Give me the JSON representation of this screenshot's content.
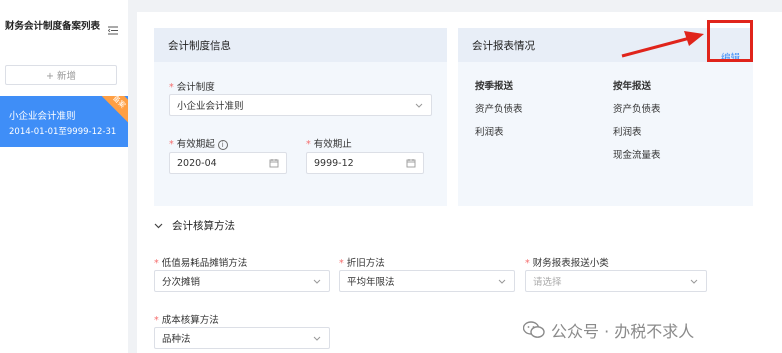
{
  "sidebar": {
    "title": "财务会计制度备案列表",
    "add_label": "+ 新增",
    "items": [
      {
        "name": "小企业会计准则",
        "range": "2014-01-01至9999-12-31",
        "badge": "备案"
      }
    ]
  },
  "system_card": {
    "title": "会计制度信息",
    "system_label": "会计制度",
    "system_value": "小企业会计准则",
    "start_label": "有效期起",
    "start_value": "2020-04",
    "end_label": "有效期止",
    "end_value": "9999-12"
  },
  "report_card": {
    "title": "会计报表情况",
    "edit_label": "编辑",
    "quarterly_header": "按季报送",
    "quarterly_items": [
      "资产负债表",
      "利润表"
    ],
    "yearly_header": "按年报送",
    "yearly_items": [
      "资产负债表",
      "利润表",
      "现金流量表"
    ]
  },
  "accounting": {
    "section_title": "会计核算方法",
    "low_value_label": "低值易耗品摊销方法",
    "low_value_value": "分次摊销",
    "depreciation_label": "折旧方法",
    "depreciation_value": "平均年限法",
    "report_type_label": "财务报表报送小类",
    "report_type_placeholder": "请选择",
    "cost_label": "成本核算方法",
    "cost_value": "品种法"
  },
  "watermark": {
    "text": "公众号 · 办税不求人"
  },
  "colors": {
    "primary": "#3f8ef7",
    "required": "#f56c6c",
    "annotation": "#e0241b"
  }
}
